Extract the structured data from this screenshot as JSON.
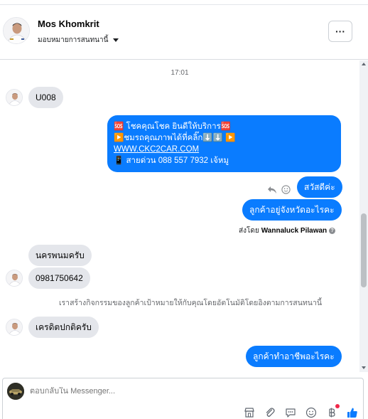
{
  "header": {
    "contact_name": "Mos Khomkrit",
    "assign_label": "มอบหมายการสนทนานี้",
    "more_label": "···"
  },
  "thread": {
    "timestamp": "17:01",
    "messages": [
      {
        "direction": "in",
        "text": "U008"
      },
      {
        "direction": "out",
        "promo_lines": [
          "🆘 โชคคุณโชค ยินดีให้บริการ🆘",
          "▶️ชมรถคุณภาพได้ที่คลิ๊ก⬇️⬇️      ▶️",
          "WWW.CKC2CAR.COM",
          "📱 สายด่วน 088 557 7932 เจ้หมู"
        ]
      },
      {
        "direction": "out",
        "text": "สวัสดีค่ะ"
      },
      {
        "direction": "out",
        "text": "ลูกค้าอยู่จังหวัดอะไรคะ"
      },
      {
        "direction": "in",
        "text": "นครพนมครับ"
      },
      {
        "direction": "in",
        "text": "0981750642"
      },
      {
        "direction": "in",
        "text": "เครดิตปกติครับ"
      },
      {
        "direction": "out",
        "text": "ลูกค้าทำอาชีพอะไรคะ"
      }
    ],
    "sent_by_prefix": "ส่งโดย",
    "sent_by_name": "Wannaluck Pilawan",
    "sent_by_info": "?",
    "event_note": "เราสร้างกิจกรรมของลูกค้าเป้าหมายให้กับคุณโดยอัตโนมัติโดยอิงตามการสนทนานี้"
  },
  "composer": {
    "placeholder": "ตอบกลับใน Messenger..."
  },
  "icons": {
    "more": "ellipsis-icon",
    "reply": "reply-icon",
    "react": "smiley-icon",
    "store": "store-icon",
    "attach": "paperclip-icon",
    "saved_replies": "chat-bubble-icon",
    "emoji": "emoji-icon",
    "payment": "baht-icon",
    "like": "thumbs-up-icon"
  },
  "colors": {
    "outgoing_bubble": "#0a7cff",
    "incoming_bubble": "#e4e6eb",
    "notification_dot": "#f02849"
  }
}
